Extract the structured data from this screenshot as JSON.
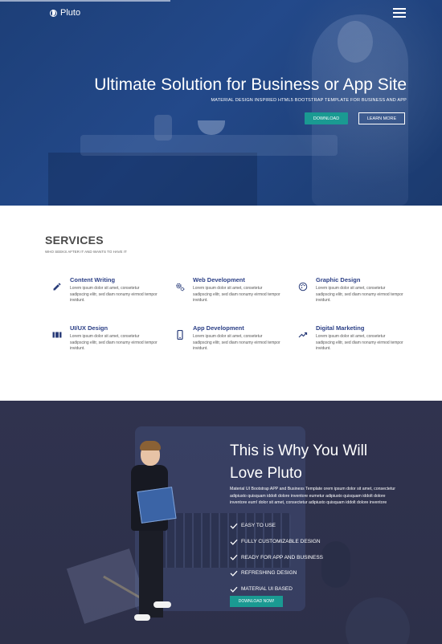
{
  "nav": {
    "brand": "Pluto",
    "logo_icon": "pluto-logo-icon",
    "menu_icon": "hamburger-menu-icon"
  },
  "hero": {
    "title": "Ultimate Solution for Business or App Site",
    "subtitle": "MATERIAL DESIGN INSPIRED HTML5 BOOTSTRAP TEMPLATE FOR BUSINESS AND APP",
    "download_label": "DOWNLOAD",
    "learn_more_label": "LEARN MORE"
  },
  "services": {
    "heading": "SERVICES",
    "subheading": "WHO SEEKS AFTER IT AND WANTS TO HAVE IT",
    "items": [
      {
        "title": "Content Writing",
        "icon": "pencil-icon",
        "text": "Lorem ipsum dolor sit amet, consetetur sadipscing elitr, sed diam nonumy eirmod tempor invidunt."
      },
      {
        "title": "Web Development",
        "icon": "gears-icon",
        "text": "Lorem ipsum dolor sit amet, consetetur sadipscing elitr, sed diam nonumy eirmod tempor invidunt."
      },
      {
        "title": "Graphic Design",
        "icon": "palette-icon",
        "text": "Lorem ipsum dolor sit amet, consetetur sadipscing elitr, sed diam nonumy eirmod tempor invidunt."
      },
      {
        "title": "UI/UX Design",
        "icon": "view-columns-icon",
        "text": "Lorem ipsum dolor sit amet, consetetur sadipscing elitr, sed diam nonumy eirmod tempor invidunt."
      },
      {
        "title": "App Development",
        "icon": "phone-icon",
        "text": "Lorem ipsum dolor sit amet, consetetur sadipscing elitr, sed diam nonumy eirmod tempor invidunt."
      },
      {
        "title": "Digital Marketing",
        "icon": "trending-up-icon",
        "text": "Lorem ipsum dolor sit amet, consetetur sadipscing elitr, sed diam nonumy eirmod tempor invidunt."
      }
    ]
  },
  "why": {
    "title_line1": "This is Why You Will",
    "title_line2": "Love Pluto",
    "description": "Material UI Bootstrap APP and Business Template orem ipsum dolor sit amet, consectetur adipiusto quisquam iddolt dolore inventore eumetur adipiusto quisquam iddolt dolore inventore eum! dolor sit amet, consectetur adipiusto quisquam iddolt dolore inventore",
    "features": [
      "EASY TO USE",
      "FULLY CUSTOMIZABLE DESIGN",
      "READY FOR APP AND BUSINESS",
      "REFRESHING DESIGN",
      "MATERIAL UI BASED"
    ],
    "button_label": "DOWNLOAD NOW!"
  },
  "colors": {
    "hero_bg": "#23498a",
    "accent_teal": "#1a9a92",
    "service_title": "#2b3f86",
    "why_bg": "#30334f"
  }
}
